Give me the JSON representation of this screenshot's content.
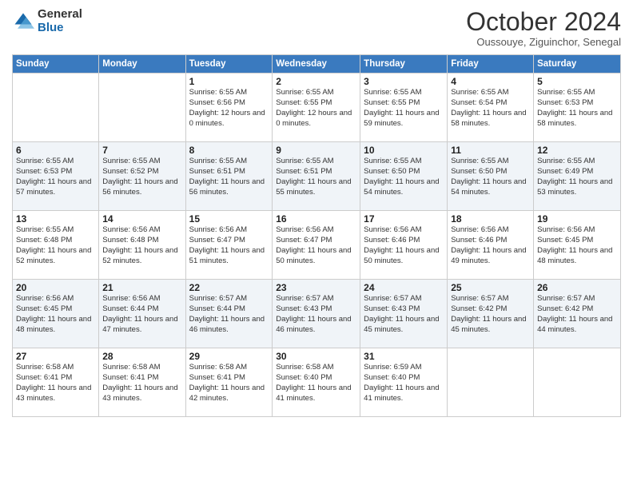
{
  "logo": {
    "general": "General",
    "blue": "Blue"
  },
  "header": {
    "month": "October 2024",
    "location": "Oussouye, Ziguinchor, Senegal"
  },
  "weekdays": [
    "Sunday",
    "Monday",
    "Tuesday",
    "Wednesday",
    "Thursday",
    "Friday",
    "Saturday"
  ],
  "weeks": [
    [
      {
        "day": "",
        "info": ""
      },
      {
        "day": "",
        "info": ""
      },
      {
        "day": "1",
        "info": "Sunrise: 6:55 AM\nSunset: 6:56 PM\nDaylight: 12 hours\nand 0 minutes."
      },
      {
        "day": "2",
        "info": "Sunrise: 6:55 AM\nSunset: 6:55 PM\nDaylight: 12 hours\nand 0 minutes."
      },
      {
        "day": "3",
        "info": "Sunrise: 6:55 AM\nSunset: 6:55 PM\nDaylight: 11 hours\nand 59 minutes."
      },
      {
        "day": "4",
        "info": "Sunrise: 6:55 AM\nSunset: 6:54 PM\nDaylight: 11 hours\nand 58 minutes."
      },
      {
        "day": "5",
        "info": "Sunrise: 6:55 AM\nSunset: 6:53 PM\nDaylight: 11 hours\nand 58 minutes."
      }
    ],
    [
      {
        "day": "6",
        "info": "Sunrise: 6:55 AM\nSunset: 6:53 PM\nDaylight: 11 hours\nand 57 minutes."
      },
      {
        "day": "7",
        "info": "Sunrise: 6:55 AM\nSunset: 6:52 PM\nDaylight: 11 hours\nand 56 minutes."
      },
      {
        "day": "8",
        "info": "Sunrise: 6:55 AM\nSunset: 6:51 PM\nDaylight: 11 hours\nand 56 minutes."
      },
      {
        "day": "9",
        "info": "Sunrise: 6:55 AM\nSunset: 6:51 PM\nDaylight: 11 hours\nand 55 minutes."
      },
      {
        "day": "10",
        "info": "Sunrise: 6:55 AM\nSunset: 6:50 PM\nDaylight: 11 hours\nand 54 minutes."
      },
      {
        "day": "11",
        "info": "Sunrise: 6:55 AM\nSunset: 6:50 PM\nDaylight: 11 hours\nand 54 minutes."
      },
      {
        "day": "12",
        "info": "Sunrise: 6:55 AM\nSunset: 6:49 PM\nDaylight: 11 hours\nand 53 minutes."
      }
    ],
    [
      {
        "day": "13",
        "info": "Sunrise: 6:55 AM\nSunset: 6:48 PM\nDaylight: 11 hours\nand 52 minutes."
      },
      {
        "day": "14",
        "info": "Sunrise: 6:56 AM\nSunset: 6:48 PM\nDaylight: 11 hours\nand 52 minutes."
      },
      {
        "day": "15",
        "info": "Sunrise: 6:56 AM\nSunset: 6:47 PM\nDaylight: 11 hours\nand 51 minutes."
      },
      {
        "day": "16",
        "info": "Sunrise: 6:56 AM\nSunset: 6:47 PM\nDaylight: 11 hours\nand 50 minutes."
      },
      {
        "day": "17",
        "info": "Sunrise: 6:56 AM\nSunset: 6:46 PM\nDaylight: 11 hours\nand 50 minutes."
      },
      {
        "day": "18",
        "info": "Sunrise: 6:56 AM\nSunset: 6:46 PM\nDaylight: 11 hours\nand 49 minutes."
      },
      {
        "day": "19",
        "info": "Sunrise: 6:56 AM\nSunset: 6:45 PM\nDaylight: 11 hours\nand 48 minutes."
      }
    ],
    [
      {
        "day": "20",
        "info": "Sunrise: 6:56 AM\nSunset: 6:45 PM\nDaylight: 11 hours\nand 48 minutes."
      },
      {
        "day": "21",
        "info": "Sunrise: 6:56 AM\nSunset: 6:44 PM\nDaylight: 11 hours\nand 47 minutes."
      },
      {
        "day": "22",
        "info": "Sunrise: 6:57 AM\nSunset: 6:44 PM\nDaylight: 11 hours\nand 46 minutes."
      },
      {
        "day": "23",
        "info": "Sunrise: 6:57 AM\nSunset: 6:43 PM\nDaylight: 11 hours\nand 46 minutes."
      },
      {
        "day": "24",
        "info": "Sunrise: 6:57 AM\nSunset: 6:43 PM\nDaylight: 11 hours\nand 45 minutes."
      },
      {
        "day": "25",
        "info": "Sunrise: 6:57 AM\nSunset: 6:42 PM\nDaylight: 11 hours\nand 45 minutes."
      },
      {
        "day": "26",
        "info": "Sunrise: 6:57 AM\nSunset: 6:42 PM\nDaylight: 11 hours\nand 44 minutes."
      }
    ],
    [
      {
        "day": "27",
        "info": "Sunrise: 6:58 AM\nSunset: 6:41 PM\nDaylight: 11 hours\nand 43 minutes."
      },
      {
        "day": "28",
        "info": "Sunrise: 6:58 AM\nSunset: 6:41 PM\nDaylight: 11 hours\nand 43 minutes."
      },
      {
        "day": "29",
        "info": "Sunrise: 6:58 AM\nSunset: 6:41 PM\nDaylight: 11 hours\nand 42 minutes."
      },
      {
        "day": "30",
        "info": "Sunrise: 6:58 AM\nSunset: 6:40 PM\nDaylight: 11 hours\nand 41 minutes."
      },
      {
        "day": "31",
        "info": "Sunrise: 6:59 AM\nSunset: 6:40 PM\nDaylight: 11 hours\nand 41 minutes."
      },
      {
        "day": "",
        "info": ""
      },
      {
        "day": "",
        "info": ""
      }
    ]
  ]
}
